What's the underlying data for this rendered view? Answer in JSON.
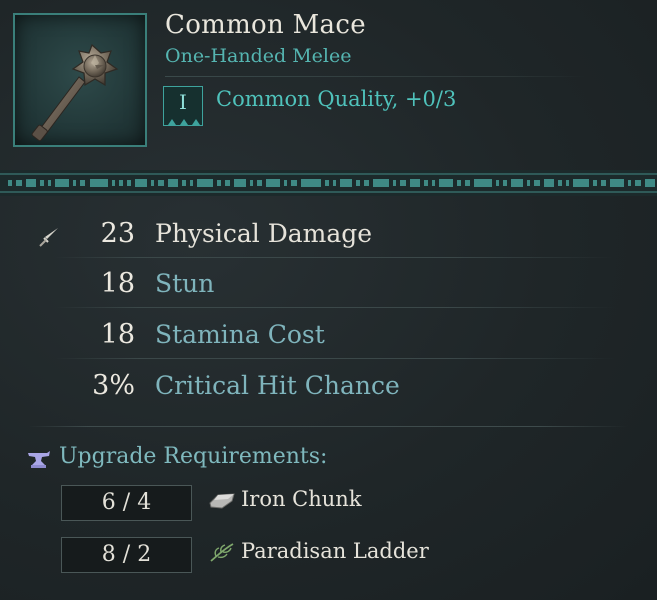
{
  "item": {
    "name": "Common Mace",
    "type": "One-Handed Melee",
    "tier": "I",
    "quality": "Common Quality, +0/3",
    "icon": "mace-icon"
  },
  "stats": [
    {
      "value": "23",
      "label": "Physical Damage",
      "label_color": "#e6e3da",
      "icon": "sword-icon"
    },
    {
      "value": "18",
      "label": "Stun",
      "label_color": "#7fb4bc"
    },
    {
      "value": "18",
      "label": "Stamina Cost",
      "label_color": "#7fb4bc"
    },
    {
      "value": "3%",
      "label": "Critical Hit Chance",
      "label_color": "#7fb4bc"
    }
  ],
  "upgrade": {
    "title": "Upgrade Requirements:",
    "icon": "anvil-icon",
    "requirements": [
      {
        "amount": "6 / 4",
        "name": "Iron Chunk",
        "icon": "iron-chunk-icon"
      },
      {
        "amount": "8 / 2",
        "name": "Paradisan Ladder",
        "icon": "plant-icon"
      }
    ]
  },
  "colors": {
    "accent": "#4fc2bb",
    "background": "#1f2628",
    "frame": "#3a7f7a"
  }
}
